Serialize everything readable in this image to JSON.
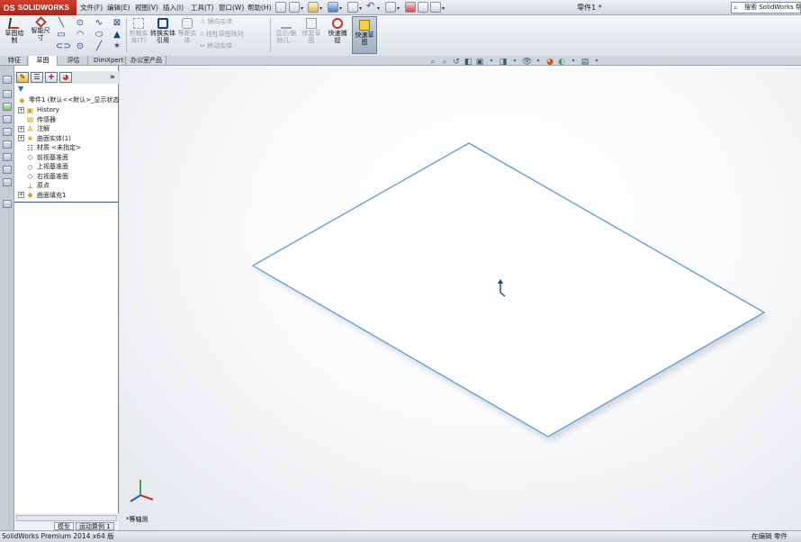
{
  "app": {
    "logo": "SOLIDWORKS",
    "logo_glyph": "DS",
    "doc_title": "零件1 *",
    "search_placeholder": "搜索 SolidWorks 帮助"
  },
  "menu": [
    "文件(F)",
    "编辑(E)",
    "视图(V)",
    "插入(I)",
    "工具(T)",
    "窗口(W)",
    "帮助(H)"
  ],
  "ribbon": {
    "sketch_draw": "草图绘制",
    "smart_dim": "智能尺寸",
    "trim_entities": "剪裁实体(T)",
    "convert_entities": "转换实体引用",
    "offset_entities": "等距实体",
    "mirror_entities": "镜向实体",
    "linear_pattern": "线性草图阵列",
    "move_entities": "移动实体",
    "display_delete": "显示/删除几...",
    "repair_sketch": "修复草图",
    "quick_snaps": "快速捕捉",
    "rapid_sketch": "快速草图"
  },
  "tabs": [
    "特征",
    "草图",
    "评估",
    "DimXpert",
    "办公室产品"
  ],
  "active_tab": "草图",
  "tree": {
    "root": "零件1 (默认<<默认>_显示状态",
    "items": [
      {
        "label": "History",
        "icon": "history-icon",
        "expand": "+"
      },
      {
        "label": "传感器",
        "icon": "sensor-icon",
        "expand": ""
      },
      {
        "label": "注解",
        "icon": "annotation-icon",
        "expand": "+"
      },
      {
        "label": "曲面实体(1)",
        "icon": "surface-body-icon",
        "expand": "+"
      },
      {
        "label": "材质 <未指定>",
        "icon": "material-icon",
        "expand": ""
      },
      {
        "label": "前视基准面",
        "icon": "plane-icon",
        "expand": ""
      },
      {
        "label": "上视基准面",
        "icon": "plane-icon",
        "expand": ""
      },
      {
        "label": "右视基准面",
        "icon": "plane-icon",
        "expand": ""
      },
      {
        "label": "原点",
        "icon": "origin-icon",
        "expand": ""
      },
      {
        "label": "曲面填充1",
        "icon": "fill-surface-icon",
        "expand": "+"
      }
    ]
  },
  "bottom_tabs": [
    "模型",
    "运动算例 1"
  ],
  "viewport": {
    "view_name": "*等轴测"
  },
  "status": {
    "left": "SolidWorks Premium 2014 x64 版",
    "right": "在编辑 零件"
  },
  "colors": {
    "accent_red": "#c0392b",
    "ribbon_bg": "#e4e8ee",
    "selection": "#3a5c88"
  }
}
